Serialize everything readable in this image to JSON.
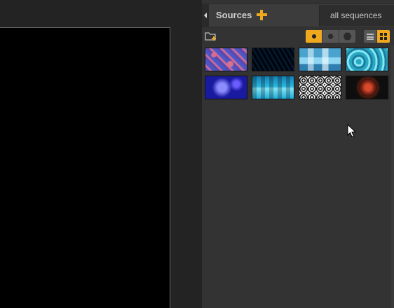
{
  "panel": {
    "title": "Sources",
    "add_icon": "plus-icon",
    "filter": "all sequences",
    "accent": "#f0a91f"
  },
  "toolbar": {
    "new_folder_icon": "new-folder-icon",
    "shape_modes": [
      "circle",
      "small-hexagon",
      "large-hexagon"
    ],
    "active_shape": "circle",
    "view_modes": [
      "list",
      "grid"
    ],
    "active_view": "grid"
  },
  "thumbnails": [
    {
      "id": 1
    },
    {
      "id": 2
    },
    {
      "id": 3
    },
    {
      "id": 4
    },
    {
      "id": 5
    },
    {
      "id": 6
    },
    {
      "id": 7
    },
    {
      "id": 8
    }
  ]
}
